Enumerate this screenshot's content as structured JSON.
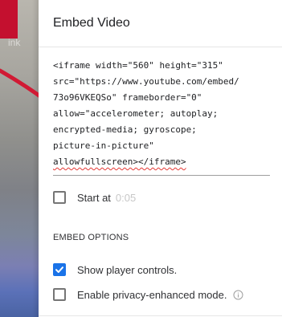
{
  "side": {
    "link_text": "ink"
  },
  "dialog": {
    "title": "Embed Video",
    "code_lines": [
      "<iframe width=\"560\" height=\"315\"",
      "src=\"https://www.youtube.com/embed/",
      "73o96VKEQSo\" frameborder=\"0\"",
      "allow=\"accelerometer; autoplay;",
      "encrypted-media; gyroscope;",
      "picture-in-picture\"",
      "allowfullscreen></iframe>"
    ],
    "start_at": {
      "label": "Start at",
      "time": "0:05",
      "checked": false
    },
    "embed_options": {
      "title": "EMBED OPTIONS",
      "options": [
        {
          "label": "Show player controls.",
          "checked": true
        },
        {
          "label": "Enable privacy-enhanced mode.",
          "checked": false
        }
      ]
    }
  },
  "colors": {
    "accent_blue": "#1a73e8",
    "red_tab": "#c4102f",
    "spellcheck_red": "#e53935"
  },
  "icons": [
    "arrow-icon",
    "checkmark-icon",
    "info-icon"
  ]
}
